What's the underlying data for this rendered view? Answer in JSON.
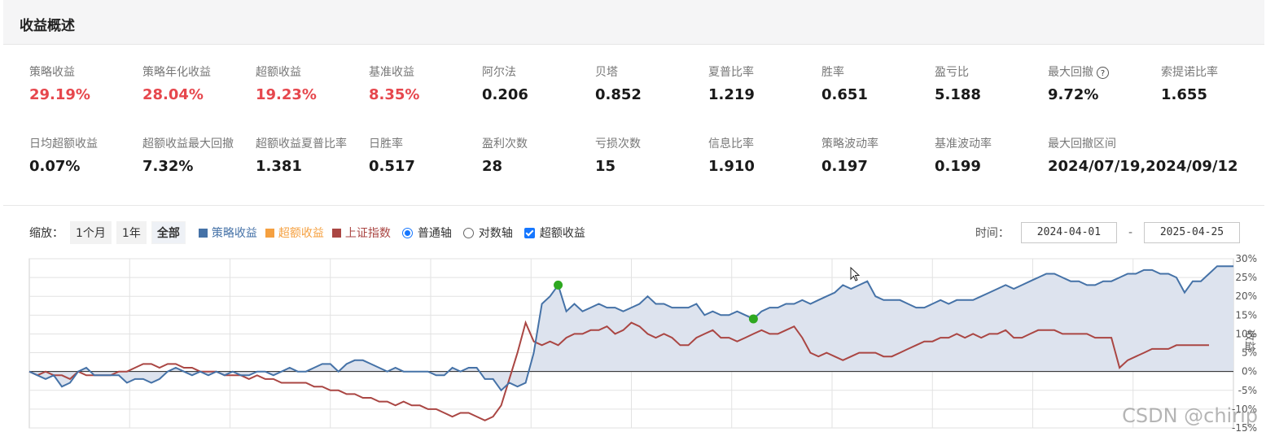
{
  "header": {
    "title": "收益概述"
  },
  "metrics_row1": [
    {
      "label": "策略收益",
      "value": "29.19%",
      "red": true
    },
    {
      "label": "策略年化收益",
      "value": "28.04%",
      "red": true
    },
    {
      "label": "超额收益",
      "value": "19.23%",
      "red": true
    },
    {
      "label": "基准收益",
      "value": "8.35%",
      "red": true
    },
    {
      "label": "阿尔法",
      "value": "0.206",
      "red": false
    },
    {
      "label": "贝塔",
      "value": "0.852",
      "red": false
    },
    {
      "label": "夏普比率",
      "value": "1.219",
      "red": false
    },
    {
      "label": "胜率",
      "value": "0.651",
      "red": false
    },
    {
      "label": "盈亏比",
      "value": "5.188",
      "red": false
    },
    {
      "label": "最大回撤",
      "value": "9.72%",
      "red": false
    },
    {
      "label": "索提诺比率",
      "value": "1.655",
      "red": false
    }
  ],
  "metrics_row2": [
    {
      "label": "日均超额收益",
      "value": "0.07%"
    },
    {
      "label": "超额收益最大回撤",
      "value": "7.32%"
    },
    {
      "label": "超额收益夏普比率",
      "value": "1.381"
    },
    {
      "label": "日胜率",
      "value": "0.517"
    },
    {
      "label": "盈利次数",
      "value": "28"
    },
    {
      "label": "亏损次数",
      "value": "15"
    },
    {
      "label": "信息比率",
      "value": "1.910"
    },
    {
      "label": "策略波动率",
      "value": "0.197"
    },
    {
      "label": "基准波动率",
      "value": "0.199"
    },
    {
      "label": "最大回撤区间",
      "value": "2024/07/19,2024/09/12"
    }
  ],
  "help_icon_glyph": "?",
  "toolbar": {
    "zoom_label": "缩放：",
    "zoom_options": [
      "1个月",
      "1年",
      "全部"
    ],
    "zoom_active": "全部",
    "legend": [
      {
        "label": "策略收益",
        "color": "#4572a7"
      },
      {
        "label": "超额收益",
        "color": "#f5a040"
      },
      {
        "label": "上证指数",
        "color": "#aa4643"
      }
    ],
    "axis_normal": "普通轴",
    "axis_log": "对数轴",
    "axis_selected": "普通轴",
    "excess_toggle_label": "超额收益",
    "excess_toggle_checked": true
  },
  "time_range": {
    "label": "时间：",
    "start": "2024-04-01",
    "end": "2025-04-25",
    "separator": "-"
  },
  "colors": {
    "strategy": "#4572a7",
    "benchmark": "#aa4643",
    "excess": "#f5a040",
    "fill": "#dde3ee",
    "red_value": "#e6474d",
    "marker": "#2ea820"
  },
  "chart_data": {
    "type": "line",
    "x_start": "2024-04-01",
    "x_end": "2025-04-25",
    "y_unit": "%",
    "ylim": [
      -15,
      30
    ],
    "y_ticks": [
      "30%",
      "25%",
      "20%",
      "15%",
      "10%",
      "5%",
      "0%",
      "-5%",
      "-10%",
      "-15%"
    ],
    "ylabel": "收益",
    "grid": true,
    "series": [
      {
        "name": "策略收益",
        "values": [
          0,
          -1,
          -2,
          -1,
          -4,
          -3,
          0,
          1,
          -1,
          -1,
          -1,
          -1,
          -3,
          -2,
          -2,
          -3,
          -2,
          0,
          1,
          0,
          -1,
          0,
          -1,
          0,
          -1,
          0,
          -1,
          -1,
          0,
          0,
          -1,
          0,
          1,
          0,
          0,
          1,
          2,
          2,
          0,
          2,
          3,
          3,
          2,
          1,
          0,
          1,
          0,
          0,
          0,
          0,
          -1,
          -1,
          1,
          0,
          1,
          1,
          -2,
          -2,
          -5,
          -3,
          -4,
          -3,
          5,
          18,
          20,
          23,
          16,
          18,
          16,
          17,
          18,
          17,
          17,
          16,
          17,
          18,
          20,
          18,
          18,
          17,
          17,
          17,
          18,
          15,
          16,
          15,
          15,
          16,
          15,
          14,
          16,
          17,
          17,
          18,
          18,
          19,
          18,
          19,
          20,
          21,
          23,
          22,
          23,
          24,
          20,
          19,
          19,
          19,
          18,
          17,
          17,
          18,
          19,
          18,
          19,
          19,
          19,
          20,
          21,
          22,
          23,
          22,
          23,
          24,
          25,
          26,
          26,
          25,
          24,
          24,
          23,
          23,
          24,
          24,
          25,
          26,
          26,
          27,
          27,
          26,
          26,
          25,
          21,
          24,
          24,
          26,
          28,
          28,
          28
        ],
        "color": "#4572a7"
      },
      {
        "name": "上证指数",
        "values": [
          0,
          -1,
          0,
          -1,
          -1,
          -2,
          0,
          -1,
          -1,
          -1,
          -1,
          0,
          0,
          1,
          2,
          2,
          1,
          2,
          2,
          1,
          1,
          0,
          0,
          0,
          -1,
          -1,
          -1,
          -2,
          -1,
          -2,
          -2,
          -3,
          -3,
          -3,
          -3,
          -4,
          -4,
          -5,
          -5,
          -6,
          -6,
          -7,
          -7,
          -8,
          -8,
          -9,
          -8,
          -9,
          -9,
          -10,
          -10,
          -11,
          -12,
          -11,
          -11,
          -12,
          -13,
          -12,
          -9,
          -2,
          5,
          13,
          8,
          7,
          8,
          7,
          9,
          10,
          10,
          11,
          11,
          12,
          10,
          11,
          13,
          12,
          10,
          9,
          10,
          9,
          7,
          7,
          9,
          10,
          11,
          9,
          9,
          8,
          9,
          10,
          11,
          10,
          10,
          11,
          12,
          9,
          5,
          4,
          5,
          4,
          3,
          4,
          5,
          5,
          5,
          4,
          4,
          5,
          6,
          7,
          8,
          8,
          9,
          9,
          10,
          9,
          10,
          9,
          10,
          10,
          11,
          9,
          9,
          10,
          11,
          11,
          11,
          10,
          10,
          10,
          10,
          9,
          9,
          9,
          1,
          3,
          4,
          5,
          6,
          6,
          6,
          7,
          7,
          7,
          7,
          7
        ],
        "color": "#aa4643"
      }
    ]
  },
  "watermark": "CSDN @chirip"
}
